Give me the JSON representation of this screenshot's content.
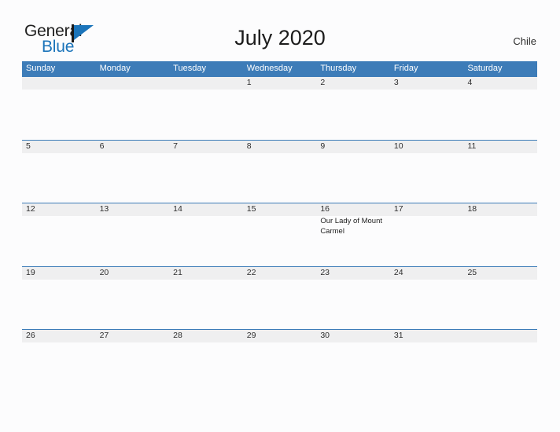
{
  "brand": {
    "name_part1": "General",
    "name_part2": "Blue",
    "flag_icon": "flag-triangle-icon",
    "accent_color": "#1b74ba"
  },
  "header": {
    "title": "July 2020",
    "country": "Chile"
  },
  "calendar": {
    "header_bg": "#3d7cb8",
    "band_bg": "#efeff0",
    "day_names": [
      "Sunday",
      "Monday",
      "Tuesday",
      "Wednesday",
      "Thursday",
      "Friday",
      "Saturday"
    ],
    "weeks": [
      {
        "band_columns": 7,
        "days": [
          {
            "num": "",
            "events": []
          },
          {
            "num": "",
            "events": []
          },
          {
            "num": "",
            "events": []
          },
          {
            "num": "1",
            "events": []
          },
          {
            "num": "2",
            "events": []
          },
          {
            "num": "3",
            "events": []
          },
          {
            "num": "4",
            "events": []
          }
        ]
      },
      {
        "band_columns": 7,
        "days": [
          {
            "num": "5",
            "events": []
          },
          {
            "num": "6",
            "events": []
          },
          {
            "num": "7",
            "events": []
          },
          {
            "num": "8",
            "events": []
          },
          {
            "num": "9",
            "events": []
          },
          {
            "num": "10",
            "events": []
          },
          {
            "num": "11",
            "events": []
          }
        ]
      },
      {
        "band_columns": 7,
        "days": [
          {
            "num": "12",
            "events": []
          },
          {
            "num": "13",
            "events": []
          },
          {
            "num": "14",
            "events": []
          },
          {
            "num": "15",
            "events": []
          },
          {
            "num": "16",
            "events": [
              "Our Lady of Mount Carmel"
            ]
          },
          {
            "num": "17",
            "events": []
          },
          {
            "num": "18",
            "events": []
          }
        ]
      },
      {
        "band_columns": 7,
        "days": [
          {
            "num": "19",
            "events": []
          },
          {
            "num": "20",
            "events": []
          },
          {
            "num": "21",
            "events": []
          },
          {
            "num": "22",
            "events": []
          },
          {
            "num": "23",
            "events": []
          },
          {
            "num": "24",
            "events": []
          },
          {
            "num": "25",
            "events": []
          }
        ]
      },
      {
        "band_columns": 7,
        "days": [
          {
            "num": "26",
            "events": []
          },
          {
            "num": "27",
            "events": []
          },
          {
            "num": "28",
            "events": []
          },
          {
            "num": "29",
            "events": []
          },
          {
            "num": "30",
            "events": []
          },
          {
            "num": "31",
            "events": []
          },
          {
            "num": "",
            "events": []
          }
        ]
      }
    ]
  }
}
